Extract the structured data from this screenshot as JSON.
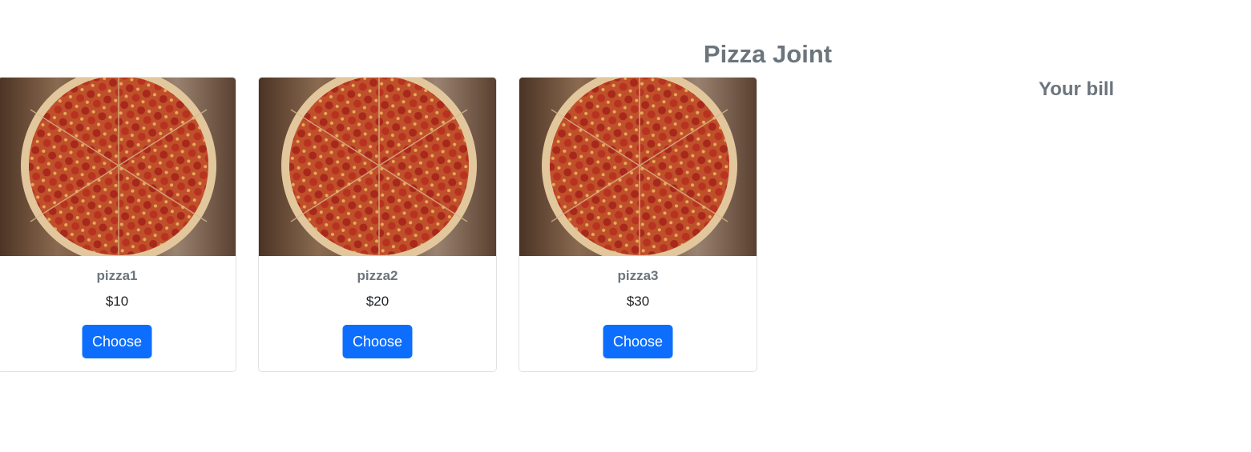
{
  "header": {
    "title": "Pizza Joint"
  },
  "bill": {
    "title": "Your bill"
  },
  "pizzas": [
    {
      "name": "pizza1",
      "price": "$10",
      "button_label": "Choose"
    },
    {
      "name": "pizza2",
      "price": "$20",
      "button_label": "Choose"
    },
    {
      "name": "pizza3",
      "price": "$30",
      "button_label": "Choose"
    }
  ],
  "colors": {
    "accent": "#0d6efd",
    "heading": "#6c757d",
    "text": "#212529",
    "card_border": "#dfe1e4"
  },
  "icons": {
    "card_image": "pepperoni-pizza-photo"
  }
}
